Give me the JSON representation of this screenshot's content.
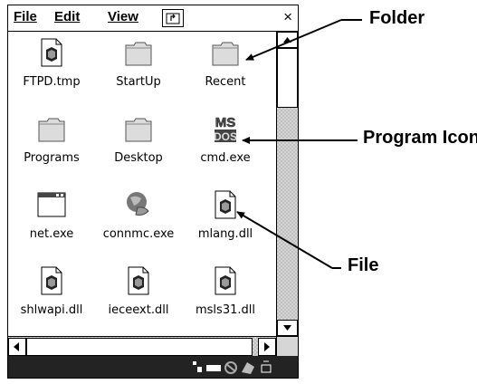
{
  "menu": {
    "file_label": "File",
    "edit_label": "Edit",
    "view_label": "View",
    "up_icon": "folder-up-icon",
    "close_label": "×"
  },
  "files": [
    {
      "name": "FTPD.tmp",
      "icon": "file-icon"
    },
    {
      "name": "StartUp",
      "icon": "folder-icon"
    },
    {
      "name": "Recent",
      "icon": "folder-icon"
    },
    {
      "name": "Programs",
      "icon": "folder-icon"
    },
    {
      "name": "Desktop",
      "icon": "folder-icon"
    },
    {
      "name": "cmd.exe",
      "icon": "msdos-icon"
    },
    {
      "name": "net.exe",
      "icon": "window-icon"
    },
    {
      "name": "connmc.exe",
      "icon": "globe-icon"
    },
    {
      "name": "mlang.dll",
      "icon": "file-icon"
    },
    {
      "name": "shlwapi.dll",
      "icon": "file-icon"
    },
    {
      "name": "ieceext.dll",
      "icon": "file-icon"
    },
    {
      "name": "msls31.dll",
      "icon": "file-icon"
    }
  ],
  "callouts": {
    "folder": "Folder",
    "program_icon": "Program Icon",
    "file": "File"
  },
  "program_icon_text": {
    "line1": "MS",
    "line2": "DOS"
  },
  "taskbar_icons": [
    "network-icon",
    "battery-icon",
    "no-signal-icon",
    "keyboard-icon",
    "input-icon"
  ]
}
